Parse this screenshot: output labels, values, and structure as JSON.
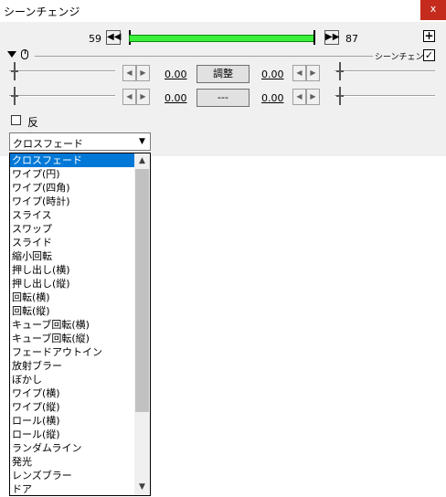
{
  "window": {
    "title": "シーンチェンジ",
    "close_label": "x"
  },
  "timeline": {
    "start_frame": "59",
    "end_frame": "87",
    "prev_icon": "◀◀",
    "next_icon": "▶▶",
    "plus_label": "+"
  },
  "section": {
    "label": "シーンチェンジ",
    "checked_mark": "✓"
  },
  "params": {
    "row1": {
      "left_value": "0.00",
      "button_label": "調整",
      "right_value": "0.00"
    },
    "row2": {
      "left_value": "0.00",
      "button_label": "---",
      "right_value": "0.00"
    }
  },
  "flip": {
    "label": "反転"
  },
  "combo": {
    "selected": "クロスフェード",
    "arrow": "▼"
  },
  "dropdown": {
    "items": [
      "クロスフェード",
      "ワイプ(円)",
      "ワイプ(四角)",
      "ワイプ(時計)",
      "スライス",
      "スワップ",
      "スライド",
      "縮小回転",
      "押し出し(横)",
      "押し出し(縦)",
      "回転(横)",
      "回転(縦)",
      "キューブ回転(横)",
      "キューブ回転(縦)",
      "フェードアウトイン",
      "放射ブラー",
      "ぼかし",
      "ワイプ(横)",
      "ワイプ(縦)",
      "ロール(横)",
      "ロール(縦)",
      "ランダムライン",
      "発光",
      "レンズブラー",
      "ドア"
    ],
    "scroll_up": "▲",
    "scroll_down": "▼"
  },
  "arrows": {
    "left": "◀",
    "right": "▶"
  }
}
